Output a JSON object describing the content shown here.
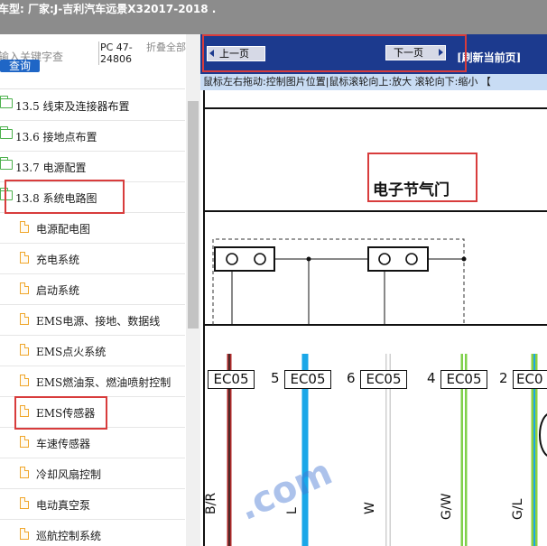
{
  "header": {
    "title": "车型:  厂家:J-吉利汽车远景X32017-2018   ."
  },
  "sidebar": {
    "search_placeholder": "输入关键字查",
    "query_button": "查询",
    "pc_label": "PC 47-24806",
    "fold_all": "折叠全部",
    "items": [
      {
        "type": "folder",
        "label": "13.5 线束及连接器布置"
      },
      {
        "type": "folder",
        "label": "13.6 接地点布置"
      },
      {
        "type": "folder",
        "label": "13.7 电源配置"
      },
      {
        "type": "folder",
        "label": "13.8 系统电路图"
      },
      {
        "type": "file",
        "label": "电源配电图"
      },
      {
        "type": "file",
        "label": "充电系统"
      },
      {
        "type": "file",
        "label": "启动系统"
      },
      {
        "type": "file",
        "label": "EMS电源、接地、数据线"
      },
      {
        "type": "file",
        "label": "EMS点火系统"
      },
      {
        "type": "file",
        "label": "EMS燃油泵、燃油喷射控制"
      },
      {
        "type": "file",
        "label": "EMS传感器"
      },
      {
        "type": "file",
        "label": "车速传感器"
      },
      {
        "type": "file",
        "label": "冷却风扇控制"
      },
      {
        "type": "file",
        "label": "电动真空泵"
      },
      {
        "type": "file",
        "label": "巡航控制系统"
      }
    ]
  },
  "toolbar": {
    "prev_label": "上一页",
    "next_label": "下一页",
    "refresh_label": "[刷新当前页]"
  },
  "hint": "鼠标左右拖动:控制图片位置|鼠标滚轮向上:放大  滚轮向下:缩小 【",
  "diagram": {
    "title": "电子节气门",
    "connectors": [
      {
        "label": "EC05",
        "pin": "5"
      },
      {
        "label": "EC05",
        "pin": "6"
      },
      {
        "label": "EC05",
        "pin": "4"
      },
      {
        "label": "EC05",
        "pin": "2"
      },
      {
        "label": "EC0",
        "pin": ""
      }
    ],
    "wires": [
      {
        "code": "B/R",
        "color": "#b02a2a"
      },
      {
        "code": "L",
        "color": "#1aa7e8"
      },
      {
        "code": "W",
        "color": "#d9d9d9"
      },
      {
        "code": "G/W",
        "color": "#7fd04a"
      },
      {
        "code": "G/L",
        "color": "#8bcf3f"
      }
    ],
    "watermark": ".com"
  },
  "colors": {
    "navbar": "#1c3a8e",
    "hintbar": "#c8dcf4",
    "annotation_red": "#d83c3c",
    "folder_icon": "#4bb04b",
    "file_icon": "#f0a62b"
  }
}
